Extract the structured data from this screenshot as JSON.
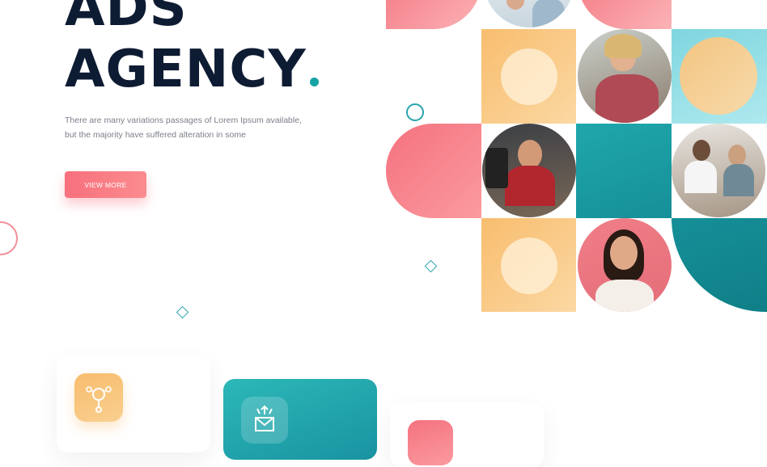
{
  "hero": {
    "title_line1": "ADS",
    "title_line2": "AGENCY",
    "description_line1": "There are many variations passages of Lorem Ipsum available,",
    "description_line2": "but the majority have suffered alteration in some",
    "button_label": "VIEW MORE"
  },
  "colors": {
    "navy": "#0e1c33",
    "teal": "#16a3a3",
    "pink": "#f7707d",
    "peach": "#f9c47d"
  },
  "icons": {
    "card1": "bulb-network-icon",
    "card2": "envelope-arrows-icon"
  }
}
